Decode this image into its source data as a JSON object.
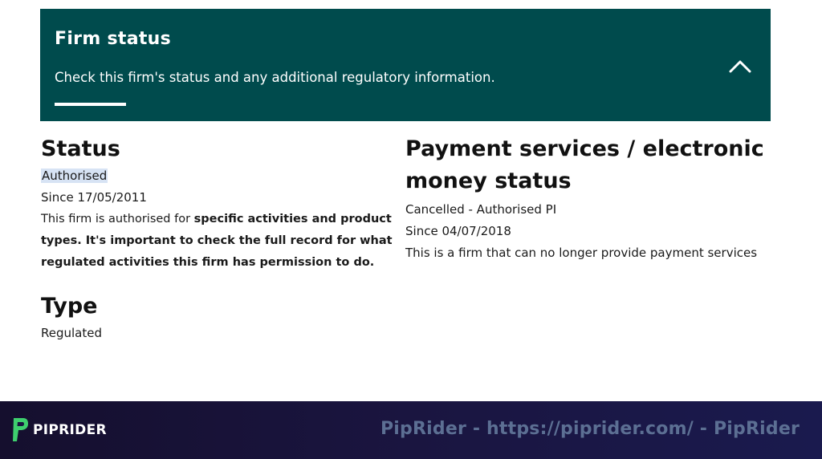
{
  "firm_status_panel": {
    "title": "Firm status",
    "description": "Check this firm's status and any additional regulatory information.",
    "collapse_icon": "chevron-up-icon",
    "background": "#004b4d"
  },
  "status": {
    "heading": "Status",
    "value": "Authorised",
    "since": "Since 17/05/2011",
    "note_plain": "This firm is authorised for ",
    "note_bold": "specific activities and product types. It's important to check the full record for what regulated activities this firm has permission to do."
  },
  "payment_services": {
    "heading_line1": "Payment services / electronic",
    "heading_line2": "money status",
    "value": "Cancelled - Authorised PI",
    "since": "Since 04/07/2018",
    "note": "This is a firm that can no longer provide payment services"
  },
  "type": {
    "heading": "Type",
    "value": "Regulated"
  },
  "footer": {
    "logo_text": "PIPRIDER",
    "logo_icon": "piprider-logo-icon",
    "watermark": "PipRider - https://piprider.com/ - PipRider"
  }
}
